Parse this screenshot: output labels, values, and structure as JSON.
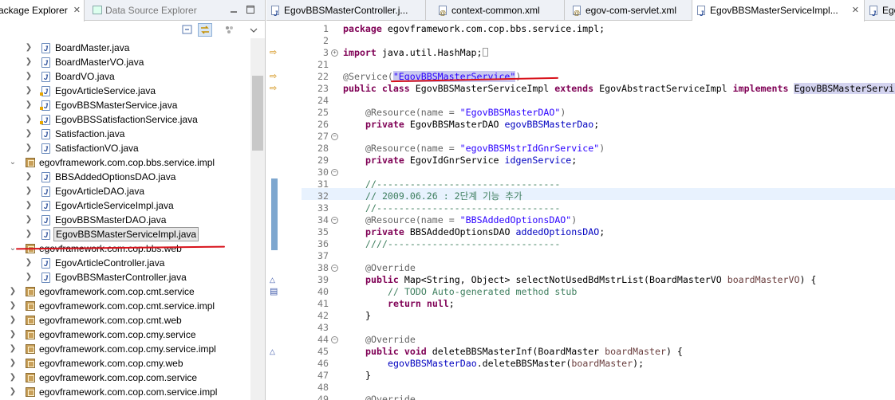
{
  "left_panel": {
    "tab_package_explorer": "ackage Explorer",
    "tab_close": "✕",
    "tab_data_source": "Data Source Explorer",
    "tree": [
      {
        "label": "BoardMaster.java",
        "type": "file"
      },
      {
        "label": "BoardMasterVO.java",
        "type": "file"
      },
      {
        "label": "BoardVO.java",
        "type": "file"
      },
      {
        "label": "EgovArticleService.java",
        "type": "file"
      },
      {
        "label": "EgovBBSMasterService.java",
        "type": "file"
      },
      {
        "label": "EgovBBSSatisfactionService.java",
        "type": "file"
      },
      {
        "label": "Satisfaction.java",
        "type": "file"
      },
      {
        "label": "SatisfactionVO.java",
        "type": "file"
      },
      {
        "label": "egovframework.com.cop.bbs.service.impl",
        "type": "package"
      },
      {
        "label": "BBSAddedOptionsDAO.java",
        "type": "file"
      },
      {
        "label": "EgovArticleDAO.java",
        "type": "file"
      },
      {
        "label": "EgovArticleServiceImpl.java",
        "type": "file"
      },
      {
        "label": "EgovBBSMasterDAO.java",
        "type": "file"
      },
      {
        "label": "EgovBBSMasterServiceImpl.java",
        "type": "file"
      },
      {
        "label": "egovframework.com.cop.bbs.web",
        "type": "package"
      },
      {
        "label": "EgovArticleController.java",
        "type": "file"
      },
      {
        "label": "EgovBBSMasterController.java",
        "type": "file"
      },
      {
        "label": "egovframework.com.cop.cmt.service",
        "type": "package"
      },
      {
        "label": "egovframework.com.cop.cmt.service.impl",
        "type": "package"
      },
      {
        "label": "egovframework.com.cop.cmt.web",
        "type": "package"
      },
      {
        "label": "egovframework.com.cop.cmy.service",
        "type": "package"
      },
      {
        "label": "egovframework.com.cop.cmy.service.impl",
        "type": "package"
      },
      {
        "label": "egovframework.com.cop.cmy.web",
        "type": "package"
      },
      {
        "label": "egovframework.com.cop.com.service",
        "type": "package"
      },
      {
        "label": "egovframework.com.cop.com.service.impl",
        "type": "package"
      }
    ]
  },
  "editor": {
    "tabs": [
      {
        "label": "EgovBBSMasterController.j..."
      },
      {
        "label": "context-common.xml"
      },
      {
        "label": "egov-com-servlet.xml"
      },
      {
        "label": "EgovBBSMasterServiceImpl..."
      },
      {
        "label": "Egov"
      }
    ],
    "line_numbers": [
      "1",
      "2",
      "3",
      "21",
      "22",
      "23",
      "24",
      "25",
      "26",
      "27",
      "28",
      "29",
      "30",
      "31",
      "32",
      "33",
      "34",
      "35",
      "36",
      "37",
      "38",
      "39",
      "40",
      "41",
      "42",
      "43",
      "44",
      "45",
      "46",
      "47",
      "48",
      "49"
    ],
    "code": {
      "l1_kw": "package",
      "l1_rest": " egovframework.com.cop.bbs.service.impl;",
      "l3_kw": "import",
      "l3_rest": " java.util.HashMap;",
      "l22_ann": "@Service(",
      "l22_str": "\"EgovBBSMasterService\"",
      "l22_close": ")",
      "l23_kw1": "public class",
      "l23_cls": "EgovBBSMasterServiceImpl",
      "l23_kw2": "extends",
      "l23_parent": "EgovAbstractServiceImpl",
      "l23_kw3": "implements",
      "l23_iface": "EgovBBSMasterService",
      "l23_brace": " {",
      "l25_ann": "@Resource(name = ",
      "l25_str": "\"EgovBBSMasterDAO\"",
      "l25_close": ")",
      "l26_kw": "private",
      "l26_type": " EgovBBSMasterDAO ",
      "l26_fld": "egovBBSMasterDao",
      "l26_end": ";",
      "l28_ann": "@Resource(name = ",
      "l28_str": "\"egovBBSMstrIdGnrService\"",
      "l28_close": ")",
      "l29_kw": "private",
      "l29_type": " EgovIdGnrService ",
      "l29_fld": "idgenService",
      "l29_end": ";",
      "l31_cm": "//---------------------------------",
      "l32_cm": "// 2009.06.26 : 2단계 기능 추가",
      "l33_cm": "//---------------------------------",
      "l34_ann": "@Resource(name = ",
      "l34_str": "\"BBSAddedOptionsDAO\"",
      "l34_close": ")",
      "l35_kw": "private",
      "l35_type": " BBSAddedOptionsDAO ",
      "l35_fld": "addedOptionsDAO",
      "l35_end": ";",
      "l36_cm": "////-------------------------------",
      "l38_ann": "@Override",
      "l39_kw": "public",
      "l39_rest": " Map<String, Object> selectNotUsedBdMstrList(BoardMasterVO ",
      "l39_param": "boardMasterVO",
      "l39_end": ") {",
      "l40_cm": "// TODO Auto-generated method stub",
      "l41_kw": "return",
      "l41_kw2": "null",
      "l41_end": ";",
      "l42": "}",
      "l44_ann": "@Override",
      "l45_kw": "public void",
      "l45_rest": " deleteBBSMasterInf(BoardMaster ",
      "l45_param": "boardMaster",
      "l45_end": ") {",
      "l46_fld": "egovBBSMasterDao",
      "l46_mid": ".deleteBBSMaster(",
      "l46_param": "boardMaster",
      "l46_end": ");",
      "l47": "}",
      "l49_ann": "@Override"
    }
  },
  "colors": {
    "keyword": "#7f0055",
    "string": "#2a00ff",
    "comment": "#3f7f5f",
    "field": "#0000c0",
    "annotation_underline": "#d8121b"
  }
}
